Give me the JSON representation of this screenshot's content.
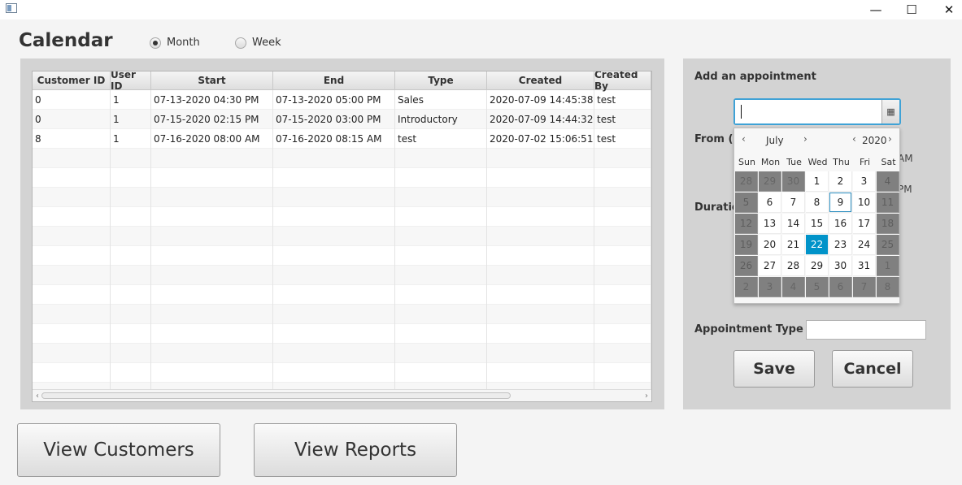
{
  "window": {
    "minimize_glyph": "—",
    "maximize_glyph": "☐",
    "close_glyph": "✕"
  },
  "header": {
    "title": "Calendar",
    "view_options": [
      {
        "label": "Month",
        "selected": true
      },
      {
        "label": "Week",
        "selected": false
      }
    ]
  },
  "table": {
    "columns": [
      "Customer ID",
      "User ID",
      "Start",
      "End",
      "Type",
      "Created",
      "Created By"
    ],
    "rows": [
      [
        "0",
        "1",
        "07-13-2020 04:30 PM",
        "07-13-2020 05:00 PM",
        "Sales",
        "2020-07-09 14:45:38.0",
        "test"
      ],
      [
        "0",
        "1",
        "07-15-2020 02:15 PM",
        "07-15-2020 03:00 PM",
        "Introductory",
        "2020-07-09 14:44:32.0",
        "test"
      ],
      [
        "8",
        "1",
        "07-16-2020 08:00 AM",
        "07-16-2020 08:15 AM",
        "test",
        "2020-07-02 15:06:51.0",
        "test"
      ]
    ],
    "scroll_left": "‹",
    "scroll_right": "›"
  },
  "appointment": {
    "heading": "Add an appointment",
    "date_value": "",
    "date_button_icon": "▦",
    "from_label": "From (8a",
    "am_label": "AM",
    "pm_label": "PM",
    "duration_label": "Duration",
    "type_label": "Appointment Type",
    "type_value": "",
    "save_label": "Save",
    "cancel_label": "Cancel"
  },
  "calendar": {
    "month": "July",
    "year": "2020",
    "prev": "‹",
    "next": "›",
    "weekdays": [
      "Sun",
      "Mon",
      "Tue",
      "Wed",
      "Thu",
      "Fri",
      "Sat"
    ],
    "weeks": [
      [
        "28",
        "29",
        "30",
        "1",
        "2",
        "3",
        "4"
      ],
      [
        "5",
        "6",
        "7",
        "8",
        "9",
        "10",
        "11"
      ],
      [
        "12",
        "13",
        "14",
        "15",
        "16",
        "17",
        "18"
      ],
      [
        "19",
        "20",
        "21",
        "22",
        "23",
        "24",
        "25"
      ],
      [
        "26",
        "27",
        "28",
        "29",
        "30",
        "31",
        "1"
      ],
      [
        "2",
        "3",
        "4",
        "5",
        "6",
        "7",
        "8"
      ]
    ],
    "today": "9",
    "selected": "22",
    "colors": {
      "selected": "#0093c9",
      "disabled": "#808080"
    }
  },
  "footer": {
    "view_customers_label": "View Customers",
    "view_reports_label": "View Reports"
  }
}
